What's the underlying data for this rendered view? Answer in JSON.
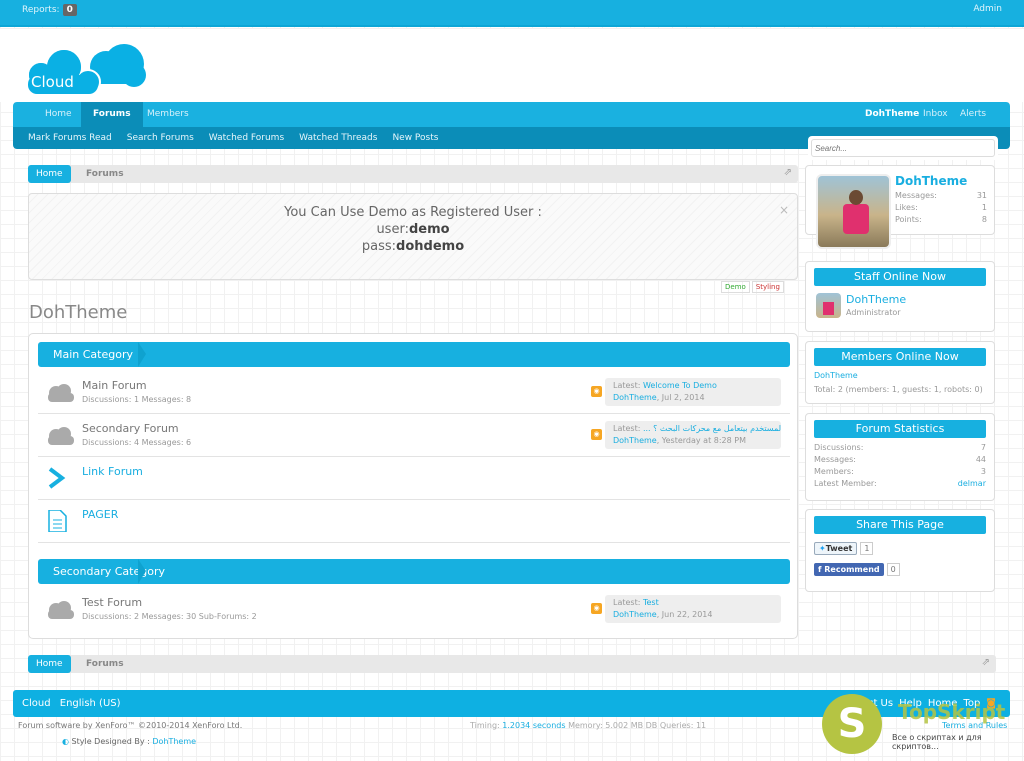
{
  "topbar": {
    "reports_label": "Reports:",
    "reports_count": "0",
    "admin": "Admin"
  },
  "logo": {
    "text": "Cloud"
  },
  "nav": {
    "tabs": [
      "Home",
      "Forums",
      "Members"
    ],
    "right": [
      "DohTheme",
      "Inbox",
      "Alerts"
    ],
    "sub": [
      "Mark Forums Read",
      "Search Forums",
      "Watched Forums",
      "Watched Threads",
      "New Posts"
    ]
  },
  "search": {
    "placeholder": "Search..."
  },
  "breadcrumb": {
    "home": "Home",
    "forums": "Forums"
  },
  "notice": {
    "line1": "You Can Use Demo as Registered User :",
    "user_label": "user:",
    "user": "demo",
    "pass_label": "pass:",
    "pass": "dohdemo",
    "tags": [
      "Demo",
      "Styling"
    ]
  },
  "page_title": "DohTheme",
  "categories": [
    {
      "title": "Main Category",
      "nodes": [
        {
          "title": "Main Forum",
          "meta": "Discussions: 1 Messages: 8",
          "latest_label": "Latest:",
          "latest": "Welcome To Demo",
          "user": "DohTheme",
          "date": ", Jul 2, 2014"
        },
        {
          "title": "Secondary Forum",
          "meta": "Discussions: 4 Messages: 6",
          "latest_label": "Latest:",
          "latest": "ازاي المستخدم بيتعامل مع محركات البحث ؟ ...",
          "user": "DohTheme",
          "date": ", Yesterday at 8:28 PM"
        },
        {
          "title": "Link Forum"
        },
        {
          "title": "PAGER"
        }
      ]
    },
    {
      "title": "Secondary Category",
      "nodes": [
        {
          "title": "Test Forum",
          "meta": "Discussions: 2 Messages: 30  Sub-Forums: 2",
          "latest_label": "Latest:",
          "latest": "Test",
          "user": "DohTheme",
          "date": ", Jun 22, 2014"
        }
      ]
    }
  ],
  "sidebar": {
    "visitor": {
      "name": "DohTheme",
      "stats": [
        [
          "Messages:",
          "31"
        ],
        [
          "Likes:",
          "1"
        ],
        [
          "Points:",
          "8"
        ]
      ]
    },
    "staff": {
      "title": "Staff Online Now",
      "name": "DohTheme",
      "role": "Administrator"
    },
    "members": {
      "title": "Members Online Now",
      "name": "DohTheme",
      "total": "Total: 2 (members: 1, guests: 1, robots: 0)"
    },
    "stats": {
      "title": "Forum Statistics",
      "rows": [
        [
          "Discussions:",
          "7"
        ],
        [
          "Messages:",
          "44"
        ],
        [
          "Members:",
          "3"
        ],
        [
          "Latest Member:",
          "delmar"
        ]
      ]
    },
    "share": {
      "title": "Share This Page",
      "tweet": "Tweet",
      "tweet_count": "1",
      "recommend": "Recommend",
      "rec_count": "0"
    }
  },
  "footer": {
    "left": [
      "Cloud",
      "English (US)"
    ],
    "right": [
      "Contact Us",
      "Help",
      "Home",
      "Top"
    ],
    "copyright": "Forum software by XenForo™ ©2010-2014 XenForo Ltd.",
    "timing_label": "Timing:",
    "timing": "1.2034 seconds",
    "memory": "Memory: 5.002 MB DB Queries: 11",
    "designed_by": "Style Designed By :",
    "designer": "DohTheme",
    "terms": "Terms and Rules",
    "watermark": "TopSkript",
    "watermark_sub": "Все о скриптах и для скриптов..."
  }
}
